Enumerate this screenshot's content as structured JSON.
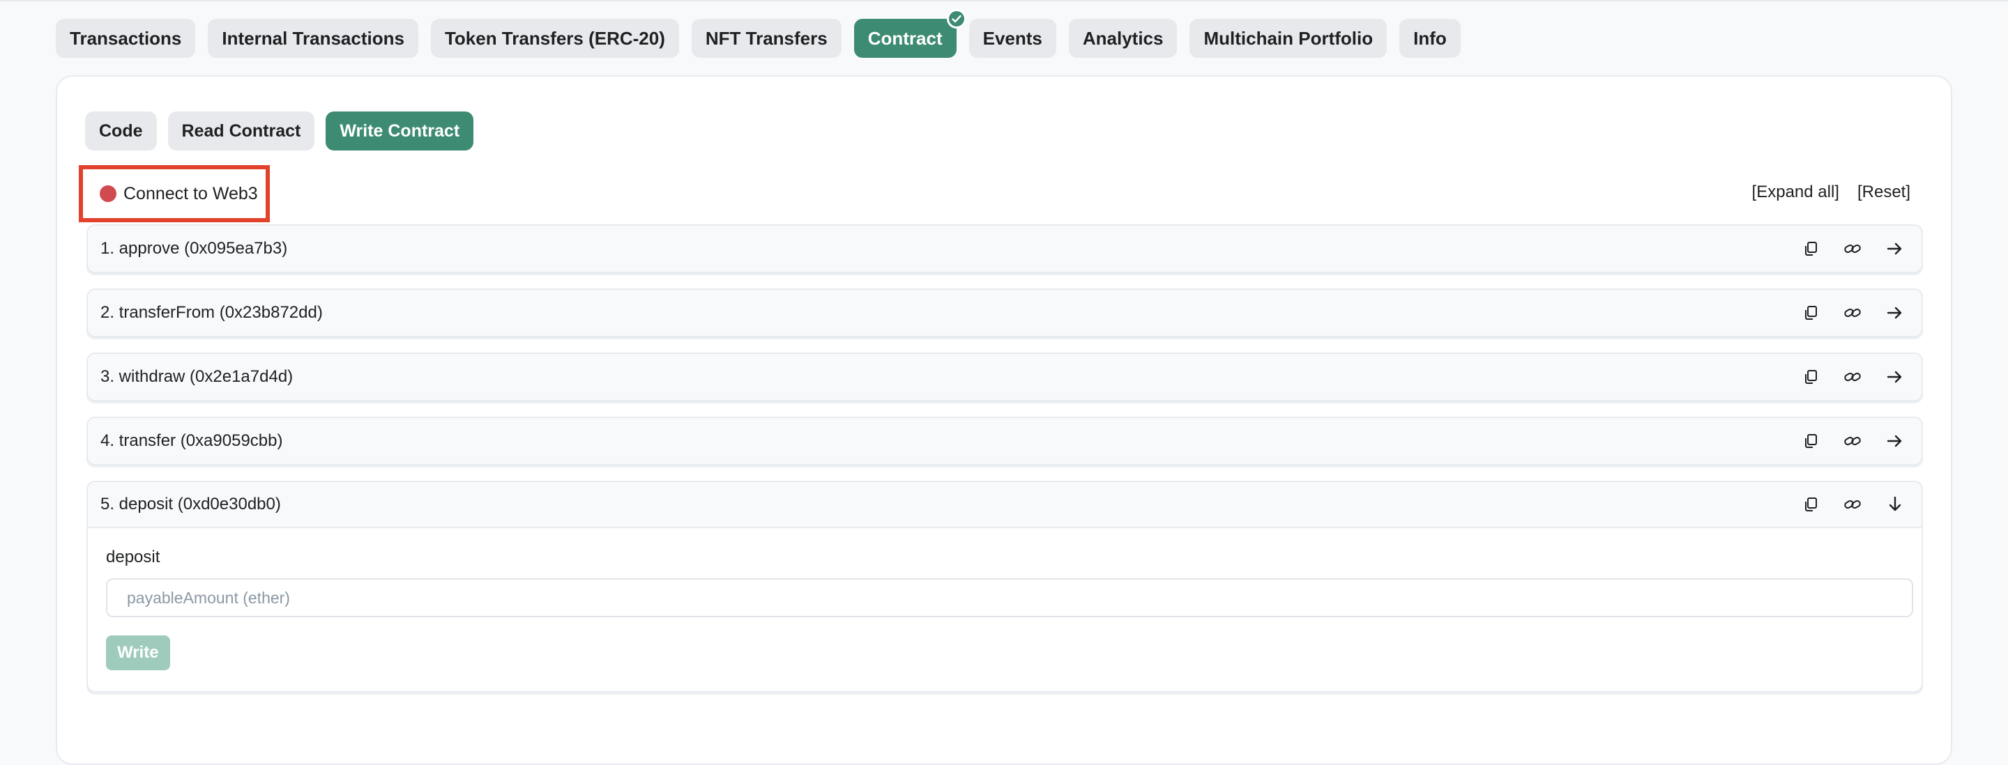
{
  "tabs": [
    {
      "label": "Transactions",
      "active": false
    },
    {
      "label": "Internal Transactions",
      "active": false
    },
    {
      "label": "Token Transfers (ERC-20)",
      "active": false
    },
    {
      "label": "NFT Transfers",
      "active": false
    },
    {
      "label": "Contract",
      "active": true,
      "verified_badge": "check-icon"
    },
    {
      "label": "Events",
      "active": false
    },
    {
      "label": "Analytics",
      "active": false
    },
    {
      "label": "Multichain Portfolio",
      "active": false
    },
    {
      "label": "Info",
      "active": false
    }
  ],
  "subtabs": [
    {
      "label": "Code",
      "active": false
    },
    {
      "label": "Read Contract",
      "active": false
    },
    {
      "label": "Write Contract",
      "active": true
    }
  ],
  "connect": {
    "label": "Connect to Web3",
    "status_color": "#d14a4f"
  },
  "actions": {
    "expand_all": "[Expand all]",
    "reset": "[Reset]"
  },
  "functions": [
    {
      "title": "1. approve (0x095ea7b3)",
      "expanded": false
    },
    {
      "title": "2. transferFrom (0x23b872dd)",
      "expanded": false
    },
    {
      "title": "3. withdraw (0x2e1a7d4d)",
      "expanded": false
    },
    {
      "title": "4. transfer (0xa9059cbb)",
      "expanded": false
    },
    {
      "title": "5. deposit (0xd0e30db0)",
      "expanded": true,
      "body": {
        "name": "deposit",
        "input_placeholder": "payableAmount (ether)",
        "button": "Write"
      }
    }
  ],
  "icons": {
    "copy": "copy-icon",
    "link": "link-icon",
    "collapsed": "arrow-right-icon",
    "expanded": "arrow-down-icon"
  },
  "colors": {
    "accent": "#3d8b72",
    "highlight_border": "#e2412b",
    "write_disabled": "#9fcbbd"
  }
}
